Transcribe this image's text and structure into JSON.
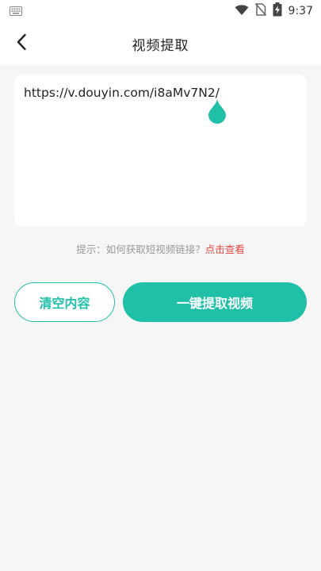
{
  "status_bar": {
    "time": "9:37",
    "icons": [
      "keyboard-icon",
      "wifi-icon",
      "no-sim-icon",
      "battery-charging-icon"
    ]
  },
  "header": {
    "back_icon": "chevron-left-icon",
    "title": "视频提取"
  },
  "input": {
    "value": "https://v.douyin.com/i8aMv7N2/"
  },
  "hint": {
    "text": "提示：如何获取短视频链接？",
    "link": "点击查看"
  },
  "buttons": {
    "clear_label": "清空内容",
    "extract_label": "一键提取视频"
  },
  "colors": {
    "accent": "#1fbfa8",
    "link": "#e64545",
    "background": "#f6f6f6"
  }
}
